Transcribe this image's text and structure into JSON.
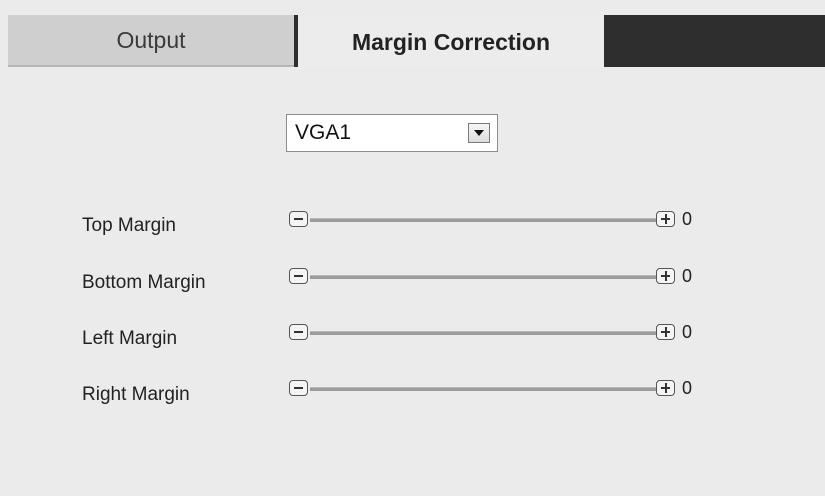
{
  "tabs": [
    {
      "label": "Output",
      "active": false
    },
    {
      "label": "Margin Correction",
      "active": true
    }
  ],
  "source_select": {
    "value": "VGA1",
    "arrow_icon": "dropdown-arrow-icon"
  },
  "margins": [
    {
      "label": "Top Margin",
      "value": "0"
    },
    {
      "label": "Bottom Margin",
      "value": "0"
    },
    {
      "label": "Left Margin",
      "value": "0"
    },
    {
      "label": "Right Margin",
      "value": "0"
    }
  ],
  "icons": {
    "decrease": "minus-icon",
    "increase": "plus-icon"
  },
  "colors": {
    "tabbar_background": "#2e2e2e",
    "active_tab": "#ececec",
    "inactive_tab": "#cfcfcf",
    "panel_background": "#ebebeb",
    "slider_track": "#9b9b9b"
  }
}
